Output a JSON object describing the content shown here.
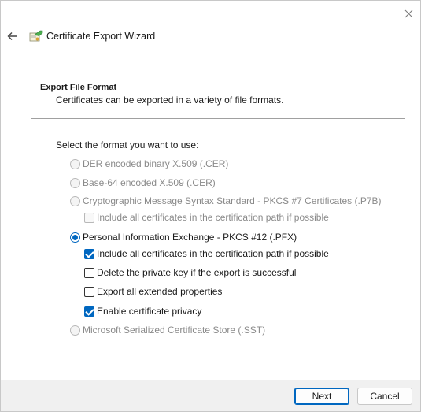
{
  "window": {
    "title": "Certificate Export Wizard",
    "icons": {
      "close": "close-icon",
      "back": "back-arrow-icon",
      "wizard": "certificate-wizard-icon"
    }
  },
  "header": {
    "title": "Export File Format",
    "description": "Certificates can be exported in a variety of file formats."
  },
  "body": {
    "prompt": "Select the format you want to use:",
    "options": {
      "der": {
        "label": "DER encoded binary X.509 (.CER)",
        "enabled": false,
        "selected": false
      },
      "base64": {
        "label": "Base-64 encoded X.509 (.CER)",
        "enabled": false,
        "selected": false
      },
      "p7b": {
        "label": "Cryptographic Message Syntax Standard - PKCS #7 Certificates (.P7B)",
        "enabled": false,
        "selected": false
      },
      "p7b_include": {
        "label": "Include all certificates in the certification path if possible",
        "enabled": false,
        "checked": false
      },
      "pfx": {
        "label": "Personal Information Exchange - PKCS #12 (.PFX)",
        "enabled": true,
        "selected": true
      },
      "pfx_include": {
        "label": "Include all certificates in the certification path if possible",
        "enabled": true,
        "checked": true
      },
      "pfx_delete_key": {
        "label": "Delete the private key if the export is successful",
        "enabled": true,
        "checked": false
      },
      "pfx_export_props": {
        "label": "Export all extended properties",
        "enabled": true,
        "checked": false
      },
      "pfx_privacy": {
        "label": "Enable certificate privacy",
        "enabled": true,
        "checked": true
      },
      "sst": {
        "label": "Microsoft Serialized Certificate Store (.SST)",
        "enabled": false,
        "selected": false
      }
    }
  },
  "footer": {
    "next_label": "Next",
    "cancel_label": "Cancel"
  },
  "colors": {
    "accent": "#0067c0",
    "disabled_text": "#8a8a8a",
    "footer_bg": "#f0f0f0"
  }
}
